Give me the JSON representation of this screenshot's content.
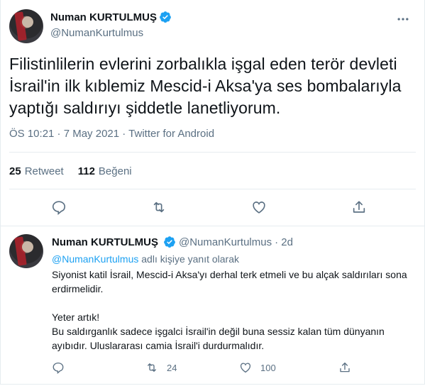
{
  "main_tweet": {
    "display_name": "Numan KURTULMUŞ",
    "handle": "@NumanKurtulmus",
    "text_lines": [
      "Filistinlilerin evlerini zorbalıkla işgal eden terör devleti",
      "İsrail'in ilk kıblemiz Mescid-i Aksa'ya ses bombalarıyla",
      "yaptığı saldırıyı şiddetle lanetliyorum."
    ],
    "meta": "ÖS 10:21 · 7 May 2021 · Twitter for Android",
    "retweet_count": "25",
    "retweet_label": "Retweet",
    "like_count": "112",
    "like_label": "Beğeni"
  },
  "reply_tweet": {
    "display_name": "Numan KURTULMUŞ",
    "handle": "@NumanKurtulmus",
    "time": "· 2d",
    "reply_to_handle": "@NumanKurtulmus",
    "reply_to_suffix": " adlı kişiye yanıt olarak",
    "paragraph1": "Siyonist katil İsrail, Mescid-i Aksa'yı derhal terk etmeli ve bu alçak saldırıları sona erdirmelidir.",
    "paragraph2": "Yeter artık!",
    "paragraph3": "Bu saldırganlık sadece işgalci İsrail'in değil buna sessiz kalan tüm dünyanın ayıbıdır. Uluslararası camia İsrail'i durdurmalıdır.",
    "retweet_count": "24",
    "like_count": "100"
  },
  "colors": {
    "accent": "#1da1f2",
    "secondary_text": "#5b7083",
    "border": "#e6ecf0"
  },
  "icons": [
    "verified-badge-icon",
    "more-icon",
    "reply-icon",
    "retweet-icon",
    "like-icon",
    "share-icon"
  ]
}
